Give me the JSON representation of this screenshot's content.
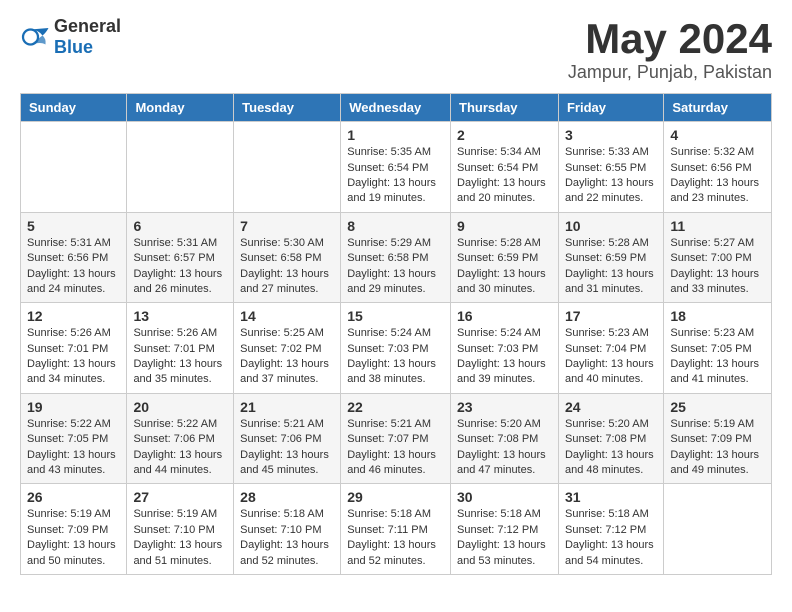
{
  "logo": {
    "general": "General",
    "blue": "Blue"
  },
  "header": {
    "title": "May 2024",
    "subtitle": "Jampur, Punjab, Pakistan"
  },
  "calendar": {
    "weekdays": [
      "Sunday",
      "Monday",
      "Tuesday",
      "Wednesday",
      "Thursday",
      "Friday",
      "Saturday"
    ],
    "weeks": [
      [
        {
          "day": "",
          "info": ""
        },
        {
          "day": "",
          "info": ""
        },
        {
          "day": "",
          "info": ""
        },
        {
          "day": "1",
          "info": "Sunrise: 5:35 AM\nSunset: 6:54 PM\nDaylight: 13 hours and 19 minutes."
        },
        {
          "day": "2",
          "info": "Sunrise: 5:34 AM\nSunset: 6:54 PM\nDaylight: 13 hours and 20 minutes."
        },
        {
          "day": "3",
          "info": "Sunrise: 5:33 AM\nSunset: 6:55 PM\nDaylight: 13 hours and 22 minutes."
        },
        {
          "day": "4",
          "info": "Sunrise: 5:32 AM\nSunset: 6:56 PM\nDaylight: 13 hours and 23 minutes."
        }
      ],
      [
        {
          "day": "5",
          "info": "Sunrise: 5:31 AM\nSunset: 6:56 PM\nDaylight: 13 hours and 24 minutes."
        },
        {
          "day": "6",
          "info": "Sunrise: 5:31 AM\nSunset: 6:57 PM\nDaylight: 13 hours and 26 minutes."
        },
        {
          "day": "7",
          "info": "Sunrise: 5:30 AM\nSunset: 6:58 PM\nDaylight: 13 hours and 27 minutes."
        },
        {
          "day": "8",
          "info": "Sunrise: 5:29 AM\nSunset: 6:58 PM\nDaylight: 13 hours and 29 minutes."
        },
        {
          "day": "9",
          "info": "Sunrise: 5:28 AM\nSunset: 6:59 PM\nDaylight: 13 hours and 30 minutes."
        },
        {
          "day": "10",
          "info": "Sunrise: 5:28 AM\nSunset: 6:59 PM\nDaylight: 13 hours and 31 minutes."
        },
        {
          "day": "11",
          "info": "Sunrise: 5:27 AM\nSunset: 7:00 PM\nDaylight: 13 hours and 33 minutes."
        }
      ],
      [
        {
          "day": "12",
          "info": "Sunrise: 5:26 AM\nSunset: 7:01 PM\nDaylight: 13 hours and 34 minutes."
        },
        {
          "day": "13",
          "info": "Sunrise: 5:26 AM\nSunset: 7:01 PM\nDaylight: 13 hours and 35 minutes."
        },
        {
          "day": "14",
          "info": "Sunrise: 5:25 AM\nSunset: 7:02 PM\nDaylight: 13 hours and 37 minutes."
        },
        {
          "day": "15",
          "info": "Sunrise: 5:24 AM\nSunset: 7:03 PM\nDaylight: 13 hours and 38 minutes."
        },
        {
          "day": "16",
          "info": "Sunrise: 5:24 AM\nSunset: 7:03 PM\nDaylight: 13 hours and 39 minutes."
        },
        {
          "day": "17",
          "info": "Sunrise: 5:23 AM\nSunset: 7:04 PM\nDaylight: 13 hours and 40 minutes."
        },
        {
          "day": "18",
          "info": "Sunrise: 5:23 AM\nSunset: 7:05 PM\nDaylight: 13 hours and 41 minutes."
        }
      ],
      [
        {
          "day": "19",
          "info": "Sunrise: 5:22 AM\nSunset: 7:05 PM\nDaylight: 13 hours and 43 minutes."
        },
        {
          "day": "20",
          "info": "Sunrise: 5:22 AM\nSunset: 7:06 PM\nDaylight: 13 hours and 44 minutes."
        },
        {
          "day": "21",
          "info": "Sunrise: 5:21 AM\nSunset: 7:06 PM\nDaylight: 13 hours and 45 minutes."
        },
        {
          "day": "22",
          "info": "Sunrise: 5:21 AM\nSunset: 7:07 PM\nDaylight: 13 hours and 46 minutes."
        },
        {
          "day": "23",
          "info": "Sunrise: 5:20 AM\nSunset: 7:08 PM\nDaylight: 13 hours and 47 minutes."
        },
        {
          "day": "24",
          "info": "Sunrise: 5:20 AM\nSunset: 7:08 PM\nDaylight: 13 hours and 48 minutes."
        },
        {
          "day": "25",
          "info": "Sunrise: 5:19 AM\nSunset: 7:09 PM\nDaylight: 13 hours and 49 minutes."
        }
      ],
      [
        {
          "day": "26",
          "info": "Sunrise: 5:19 AM\nSunset: 7:09 PM\nDaylight: 13 hours and 50 minutes."
        },
        {
          "day": "27",
          "info": "Sunrise: 5:19 AM\nSunset: 7:10 PM\nDaylight: 13 hours and 51 minutes."
        },
        {
          "day": "28",
          "info": "Sunrise: 5:18 AM\nSunset: 7:10 PM\nDaylight: 13 hours and 52 minutes."
        },
        {
          "day": "29",
          "info": "Sunrise: 5:18 AM\nSunset: 7:11 PM\nDaylight: 13 hours and 52 minutes."
        },
        {
          "day": "30",
          "info": "Sunrise: 5:18 AM\nSunset: 7:12 PM\nDaylight: 13 hours and 53 minutes."
        },
        {
          "day": "31",
          "info": "Sunrise: 5:18 AM\nSunset: 7:12 PM\nDaylight: 13 hours and 54 minutes."
        },
        {
          "day": "",
          "info": ""
        }
      ]
    ]
  }
}
